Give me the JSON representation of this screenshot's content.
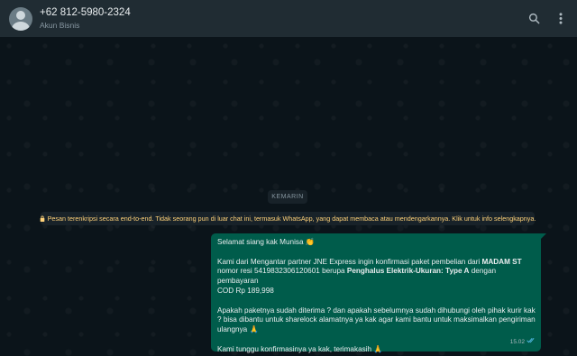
{
  "header": {
    "contact_name": "+62 812-5980-2324",
    "contact_subtitle": "Akun Bisnis",
    "search_icon": "search-icon",
    "menu_icon": "more-vert-icon"
  },
  "chat": {
    "date_label": "KEMARIN",
    "encryption_notice": "Pesan terenkripsi secara end-to-end. Tidak seorang pun di luar chat ini, termasuk WhatsApp, yang dapat membaca atau mendengarkannya. Klik untuk info selengkapnya."
  },
  "message": {
    "greeting": "Selamat siang kak Munisa",
    "greeting_emoji": "👏",
    "p2_part1": "Kami dari Mengantar partner JNE Express ingin konfirmasi paket pembelian dari ",
    "p2_bold1": "MADAM ST",
    "p2_part2": "nomor resi 5419832306120601 berupa ",
    "p2_bold2": "Penghalus Elektrik-Ukuran: Type A",
    "p2_part3": " dengan  pembayaran",
    "p2_part4": "COD Rp 189,998",
    "p3_text": "Apakah paketnya sudah diterima ? dan apakah sebelumnya sudah dihubungi oleh pihak kurir kak ? bisa dibantu untuk sharelock alamatnya ya kak agar kami bantu untuk maksimalkan pengiriman ulangnya",
    "p3_emoji": "🙏",
    "p4_text": "Kami tunggu konfirmasinya ya kak, terimakasih",
    "p4_emoji": "🙏",
    "time": "15.02",
    "status": "read"
  },
  "colors": {
    "header_bg": "#202c33",
    "chat_bg": "#0b141a",
    "outgoing_bubble": "#005c4b",
    "notice_text": "#ffd279",
    "read_tick": "#53bdeb"
  }
}
